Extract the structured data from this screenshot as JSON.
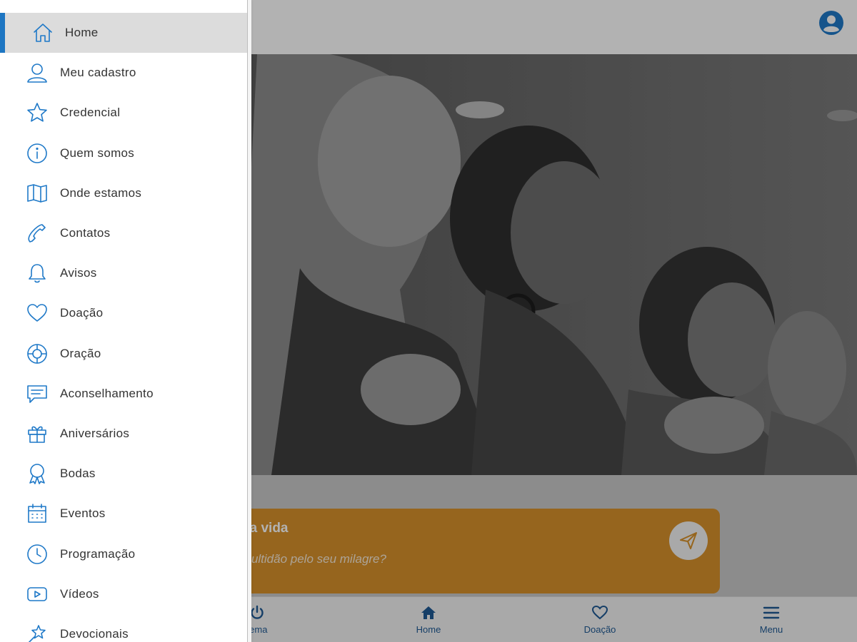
{
  "drawer": {
    "items": [
      {
        "label": "Home",
        "icon": "home-icon",
        "active": true
      },
      {
        "label": "Meu cadastro",
        "icon": "user-icon"
      },
      {
        "label": "Credencial",
        "icon": "star-icon"
      },
      {
        "label": "Quem somos",
        "icon": "info-icon"
      },
      {
        "label": "Onde estamos",
        "icon": "map-icon"
      },
      {
        "label": "Contatos",
        "icon": "phone-icon"
      },
      {
        "label": "Avisos",
        "icon": "bell-icon"
      },
      {
        "label": "Doação",
        "icon": "heart-icon"
      },
      {
        "label": "Oração",
        "icon": "lifebuoy-icon"
      },
      {
        "label": "Aconselhamento",
        "icon": "chat-icon"
      },
      {
        "label": "Aniversários",
        "icon": "gift-icon"
      },
      {
        "label": "Bodas",
        "icon": "ribbon-icon"
      },
      {
        "label": "Eventos",
        "icon": "calendar-icon"
      },
      {
        "label": "Programação",
        "icon": "clock-icon"
      },
      {
        "label": "Vídeos",
        "icon": "video-icon"
      },
      {
        "label": "Devocionais",
        "icon": "pin-star-icon"
      }
    ]
  },
  "hero": {
    "slide_count": 3,
    "active_slide": 2
  },
  "prayer_card": {
    "title": "na sua vida",
    "subtitle": "uma multidão pelo seu milagre?",
    "send_icon": "send-icon"
  },
  "bottom_nav": {
    "items": [
      {
        "label": "tema",
        "icon": "power-icon"
      },
      {
        "label": "Home",
        "icon": "home-filled-icon"
      },
      {
        "label": "Doação",
        "icon": "heart-outline-icon"
      },
      {
        "label": "Menu",
        "icon": "hamburger-icon"
      }
    ]
  },
  "colors": {
    "accent": "#1f79c8",
    "active_bar": "#1d76c2",
    "card": "#d7912b",
    "nav_text": "#1f5a94"
  }
}
